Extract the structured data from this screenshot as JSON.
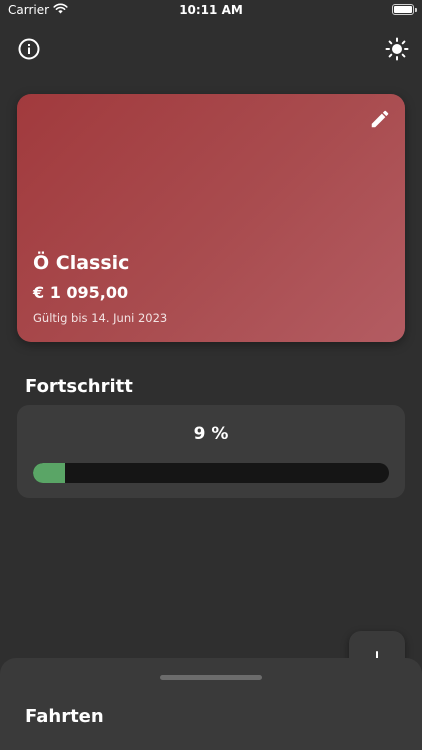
{
  "status_bar": {
    "carrier": "Carrier",
    "time": "10:11 AM"
  },
  "header": {
    "info_icon": "info-icon",
    "theme_icon": "sun-icon"
  },
  "ticket": {
    "name": "Ö Classic",
    "price": "€ 1 095,00",
    "valid_until": "Gültig bis 14. Juni 2023",
    "edit_icon": "pencil-icon",
    "gradient_start": "#a13a3d",
    "gradient_end": "#b35c62"
  },
  "progress": {
    "title": "Fortschritt",
    "label": "9 %",
    "percent": 9,
    "fill_color": "#5aa566",
    "track_color": "#151515"
  },
  "fab": {
    "icon": "plus-icon"
  },
  "bottom_sheet": {
    "title": "Fahrten"
  }
}
